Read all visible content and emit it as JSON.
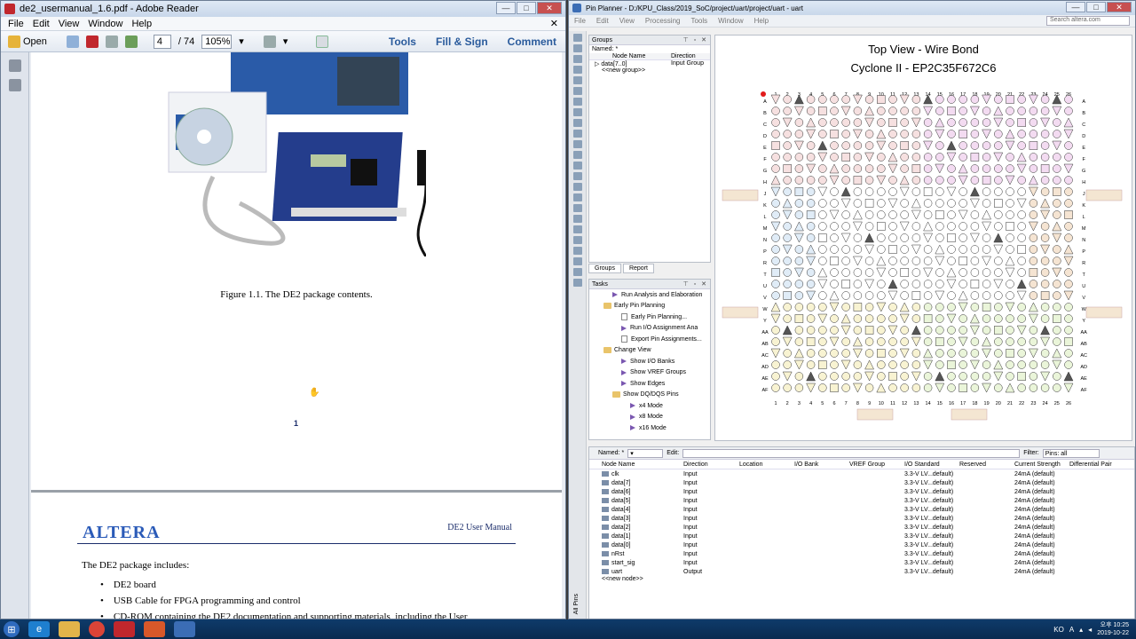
{
  "adobe": {
    "title": "de2_usermanual_1.6.pdf - Adobe Reader",
    "menu": [
      "File",
      "Edit",
      "View",
      "Window",
      "Help"
    ],
    "open_label": "Open",
    "page_current": "4",
    "page_total": "/ 74",
    "zoom": "105%",
    "tools": "Tools",
    "fill_sign": "Fill & Sign",
    "comment": "Comment",
    "figure_caption": "Figure 1.1.    The DE2 package contents.",
    "page_number": "1",
    "header_right": "DE2 User Manual",
    "logo": "ALTERA",
    "intro": "The DE2 package includes:",
    "bullets": [
      "DE2 board",
      "USB Cable for FPGA programming and control",
      "CD-ROM containing the DE2 documentation and supporting materials, including the User"
    ]
  },
  "pinplanner": {
    "title": "Pin Planner - D:/KPU_Class/2019_SoC/project/uart/project/uart - uart",
    "menu": [
      "File",
      "Edit",
      "View",
      "Processing",
      "Tools",
      "Window",
      "Help"
    ],
    "search_placeholder": "Search altera.com",
    "groups_label": "Groups",
    "named_label": "Named: *",
    "groups_cols": [
      "Node Name",
      "Direction"
    ],
    "group_row": {
      "name": "data[7..0]",
      "dir": "Input Group"
    },
    "new_group": "<<new group>>",
    "tab_groups": "Groups",
    "tab_report": "Report",
    "tasks_label": "Tasks",
    "tasks": [
      {
        "t": "Run Analysis and Elaboration",
        "k": "play",
        "ind": 2
      },
      {
        "t": "Early Pin Planning",
        "k": "fold",
        "ind": 1
      },
      {
        "t": "Early Pin Planning...",
        "k": "doc",
        "ind": 3
      },
      {
        "t": "Run I/O Assignment Ana",
        "k": "play",
        "ind": 3
      },
      {
        "t": "Export Pin Assignments...",
        "k": "doc",
        "ind": 3
      },
      {
        "t": "Change View",
        "k": "fold",
        "ind": 1
      },
      {
        "t": "Show I/O Banks",
        "k": "play",
        "ind": 3
      },
      {
        "t": "Show VREF Groups",
        "k": "play",
        "ind": 3
      },
      {
        "t": "Show Edges",
        "k": "play",
        "ind": 3
      },
      {
        "t": "Show DQ/DQS Pins",
        "k": "fold",
        "ind": 2
      },
      {
        "t": "x4 Mode",
        "k": "play",
        "ind": 4
      },
      {
        "t": "x8 Mode",
        "k": "play",
        "ind": 4
      },
      {
        "t": "x16 Mode",
        "k": "play",
        "ind": 4
      }
    ],
    "view_title": "Top View - Wire Bond",
    "device": "Cyclone II - EP2C35F672C6",
    "node_named": "Named:  *",
    "edit_label": "Edit:",
    "filter_label": "Filter:",
    "filter_value": "Pins: all",
    "columns": [
      "Node Name",
      "Direction",
      "Location",
      "I/O Bank",
      "VREF Group",
      "I/O Standard",
      "Reserved",
      "Current Strength",
      "Differential Pair"
    ],
    "nodes": [
      {
        "n": "clk",
        "d": "Input",
        "s": "3.3-V LV...default)",
        "c": "24mA (default)"
      },
      {
        "n": "data[7]",
        "d": "Input",
        "s": "3.3-V LV...default)",
        "c": "24mA (default)"
      },
      {
        "n": "data[6]",
        "d": "Input",
        "s": "3.3-V LV...default)",
        "c": "24mA (default)"
      },
      {
        "n": "data[5]",
        "d": "Input",
        "s": "3.3-V LV...default)",
        "c": "24mA (default)"
      },
      {
        "n": "data[4]",
        "d": "Input",
        "s": "3.3-V LV...default)",
        "c": "24mA (default)"
      },
      {
        "n": "data[3]",
        "d": "Input",
        "s": "3.3-V LV...default)",
        "c": "24mA (default)"
      },
      {
        "n": "data[2]",
        "d": "Input",
        "s": "3.3-V LV...default)",
        "c": "24mA (default)"
      },
      {
        "n": "data[1]",
        "d": "Input",
        "s": "3.3-V LV...default)",
        "c": "24mA (default)"
      },
      {
        "n": "data[0]",
        "d": "Input",
        "s": "3.3-V LV...default)",
        "c": "24mA (default)"
      },
      {
        "n": "nRst",
        "d": "Input",
        "s": "3.3-V LV...default)",
        "c": "24mA (default)"
      },
      {
        "n": "start_sig",
        "d": "Input",
        "s": "3.3-V LV...default)",
        "c": "24mA (default)"
      },
      {
        "n": "uart",
        "d": "Output",
        "s": "3.3-V LV...default)",
        "c": "24mA (default)"
      }
    ],
    "new_node": "<<new node>>",
    "side_label": "All Pins",
    "col_labels": [
      "1",
      "2",
      "3",
      "4",
      "5",
      "6",
      "7",
      "8",
      "9",
      "10",
      "11",
      "12",
      "13",
      "14",
      "15",
      "16",
      "17",
      "18",
      "19",
      "20",
      "21",
      "22",
      "23",
      "24",
      "25",
      "26"
    ],
    "row_labels": [
      "A",
      "B",
      "C",
      "D",
      "E",
      "F",
      "G",
      "H",
      "J",
      "K",
      "L",
      "M",
      "N",
      "P",
      "R",
      "T",
      "U",
      "V",
      "W",
      "Y",
      "AA",
      "AB",
      "AC",
      "AD",
      "AE",
      "AF"
    ]
  },
  "taskbar": {
    "lang": "KO",
    "time": "오후 10:25",
    "date": "2019-10-22"
  }
}
